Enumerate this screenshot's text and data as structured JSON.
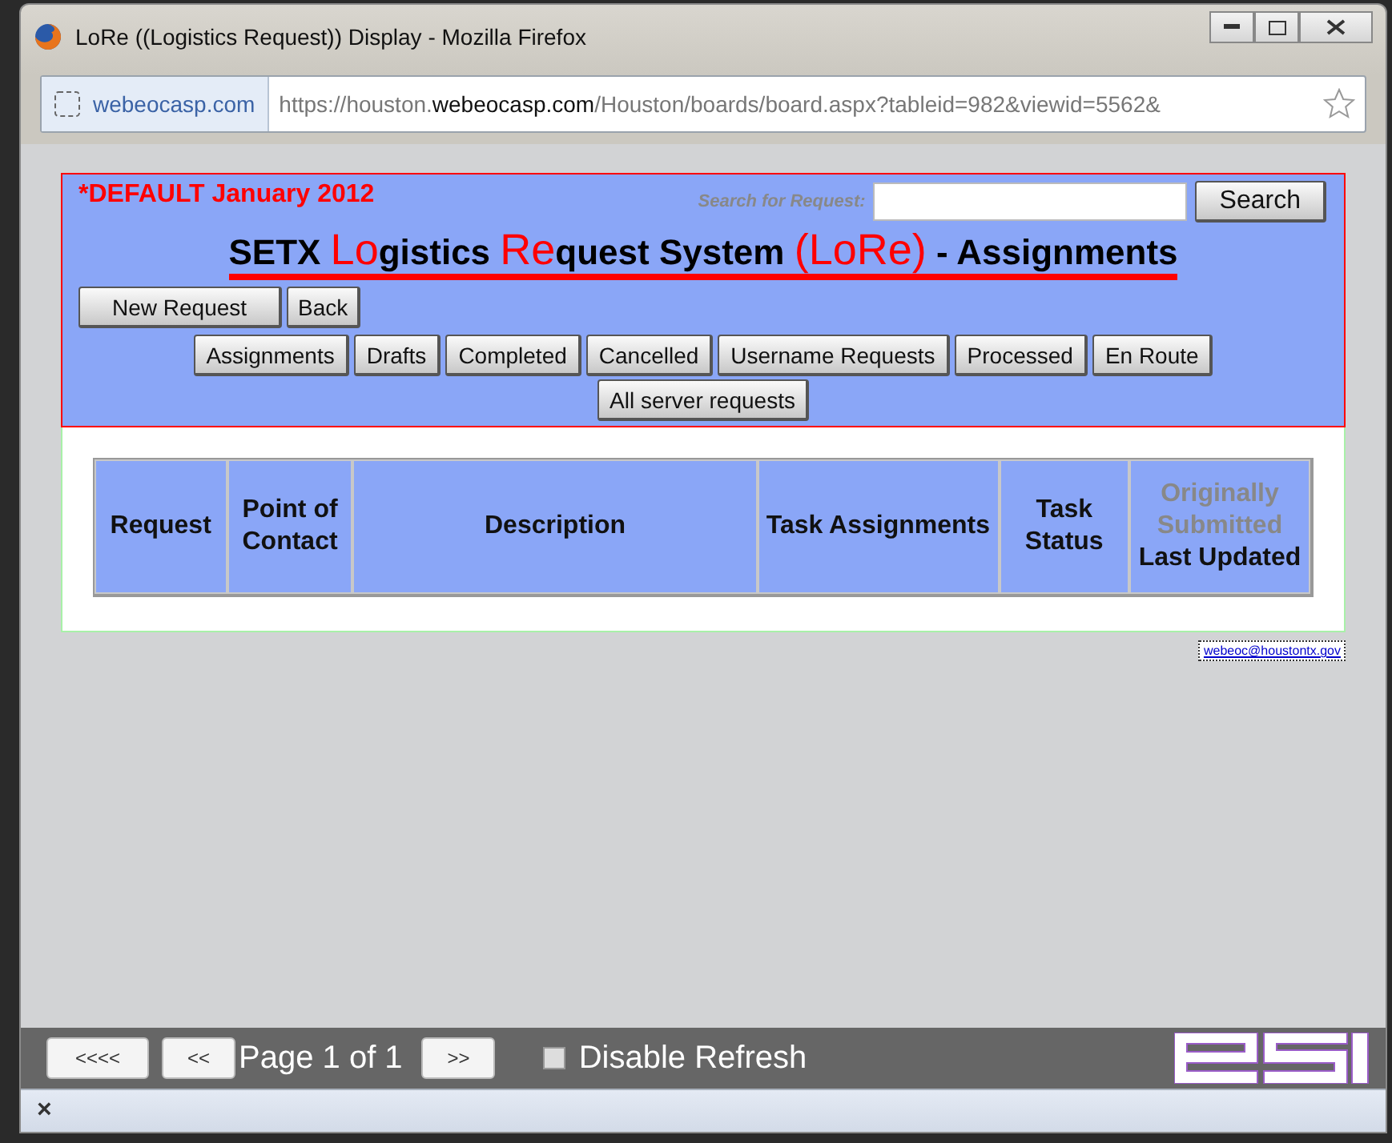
{
  "window": {
    "title": "LoRe ((Logistics Request)) Display - Mozilla Firefox"
  },
  "address_bar": {
    "site": "webeocasp.com",
    "url_prefix": "https://houston.",
    "url_domain": "webeocasp.com",
    "url_rest": "/Houston/boards/board.aspx?tableid=982&viewid=5562&"
  },
  "header": {
    "default_label": "*DEFAULT January 2012",
    "search_label": "Search for Request:",
    "search_button": "Search",
    "title": [
      {
        "text": "SETX ",
        "accent": false
      },
      {
        "text": "Lo",
        "accent": true
      },
      {
        "text": "gistics ",
        "accent": false
      },
      {
        "text": "Re",
        "accent": true
      },
      {
        "text": "quest System ",
        "accent": false
      },
      {
        "text": "(LoRe)",
        "accent": true
      },
      {
        "text": " - Assignments",
        "accent": false
      }
    ],
    "action_buttons": [
      "New Request",
      "Back"
    ],
    "view_buttons": [
      "Assignments",
      "Drafts",
      "Completed",
      "Cancelled",
      "Username Requests",
      "Processed",
      "En Route"
    ],
    "extra_buttons": [
      "All server requests"
    ]
  },
  "table": {
    "columns": [
      {
        "label": "Request"
      },
      {
        "label": "Point of Contact"
      },
      {
        "label": "Description"
      },
      {
        "label": "Task Assignments"
      },
      {
        "label": "Task Status"
      },
      {
        "note": "Originally Submitted",
        "label": "Last Updated"
      }
    ]
  },
  "contact_link": "webeoc@houstontx.gov",
  "pager": {
    "first": "<<<<",
    "prev": "<<",
    "page": "Page 1 of 1",
    "next": ">>",
    "disable_refresh": {
      "label": "Disable Refresh",
      "checked": false
    }
  },
  "status_bar": {
    "close": "×"
  }
}
